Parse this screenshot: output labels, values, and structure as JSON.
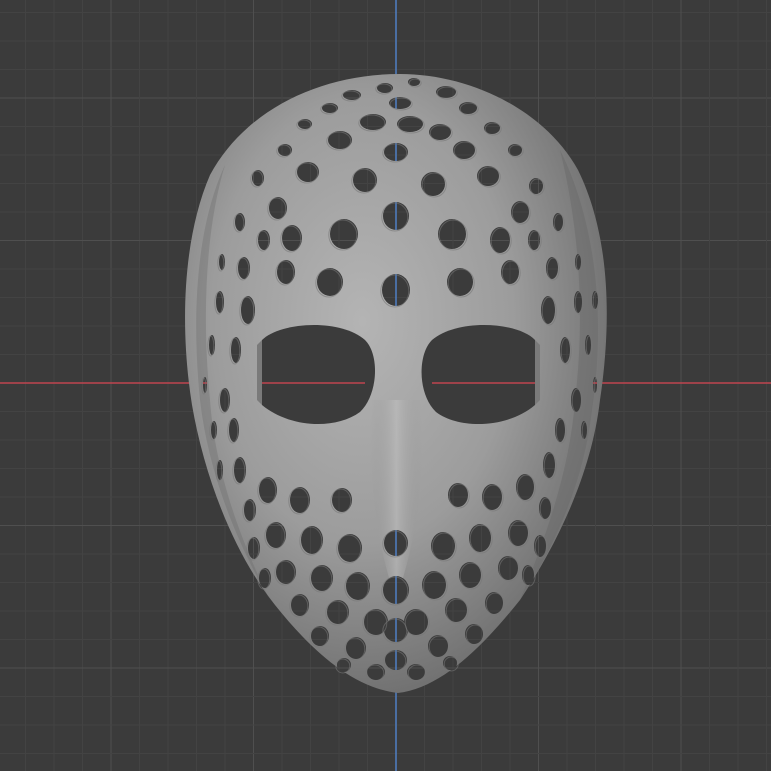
{
  "viewport": {
    "background_color": "#3b3b3b",
    "grid_minor_color": "#434343",
    "grid_major_color": "#4f4f4f",
    "x_axis_color": "#c0444f",
    "y_axis_color": "#4f7fc4",
    "grid_visible": true
  },
  "model": {
    "object_type": "mask-mesh",
    "color": "#9b9b9b",
    "hole_color": "#3b3b3b"
  }
}
